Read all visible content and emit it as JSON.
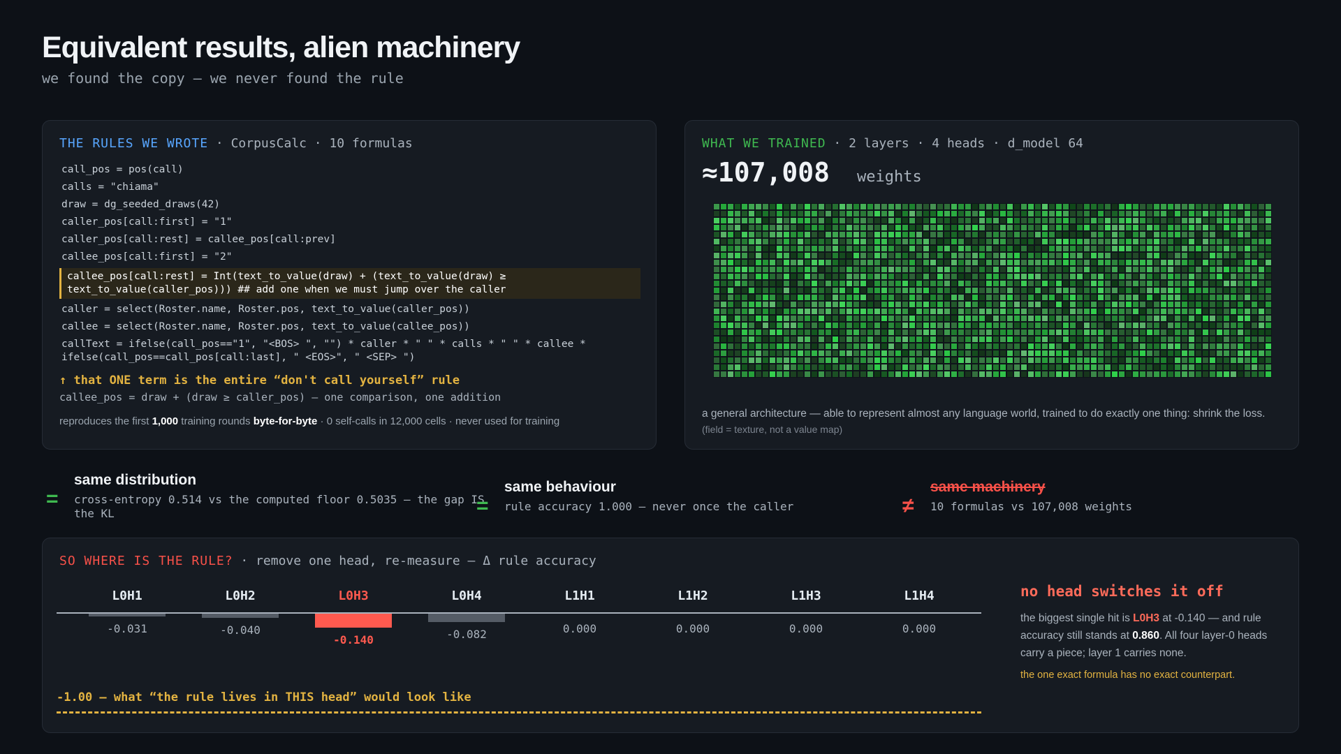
{
  "title": "Equivalent results, alien machinery",
  "subtitle": "we found the copy — we never found the rule",
  "rules_panel": {
    "head_key": "THE RULES WE WROTE",
    "head_rest": " · CorpusCalc · 10 formulas",
    "code_lines": [
      "call_pos = pos(call)",
      "calls = \"chiama\"",
      "draw = dg_seeded_draws(42)",
      "caller_pos[call:first] = \"1\"",
      "caller_pos[call:rest] = callee_pos[call:prev]",
      "callee_pos[call:first] = \"2\"",
      "callee_pos[call:rest] = Int(text_to_value(draw) + (text_to_value(draw) ≥ text_to_value(caller_pos))) ## add one when we must jump over the caller",
      "caller = select(Roster.name, Roster.pos, text_to_value(caller_pos))",
      "callee = select(Roster.name, Roster.pos, text_to_value(callee_pos))",
      "callText = ifelse(call_pos==\"1\", \"<BOS> \", \"\") * caller * \" \" * calls * \" \" * callee * ifelse(call_pos==call_pos[call:last], \" <EOS>\", \" <SEP> \")"
    ],
    "highlight_index": 6,
    "rule_note": "↑ that ONE term is the entire “don't call yourself” rule",
    "rule_formula": "callee_pos = draw + (draw ≥ caller_pos) — one comparison, one addition",
    "repro_prefix": "reproduces the first ",
    "repro_num": "1,000",
    "repro_mid": " training rounds ",
    "repro_bold": "byte-for-byte",
    "repro_suffix": " · 0 self-calls in 12,000 cells · never used for training"
  },
  "trained_panel": {
    "head_key": "WHAT WE TRAINED",
    "head_rest": " · 2 layers · 4 heads · d_model 64",
    "weights_num": "≈107,008",
    "weights_label": "weights",
    "note": "a general architecture — able to represent almost any language world, trained to do exactly one thing: shrink the loss.",
    "note_small": "(field = texture, not a value map)"
  },
  "comparisons": [
    {
      "symbol": "=",
      "title": "same distribution",
      "sub": "cross-entropy 0.514 vs the computed floor 0.5035 — the gap IS the KL",
      "color": "#3fb950"
    },
    {
      "symbol": "=",
      "title": "same behaviour",
      "sub": "rule accuracy 1.000 — never once the caller",
      "color": "#3fb950"
    },
    {
      "symbol": "≠",
      "title": "same machinery",
      "sub": "10 formulas vs 107,008 weights",
      "color": "#f85149"
    }
  ],
  "where_panel": {
    "head_key": "SO WHERE IS THE RULE?",
    "head_rest": " · remove one head, re-measure — Δ rule accuracy",
    "heads": [
      {
        "label": "L0H1",
        "value": "-0.031",
        "delta": -0.031
      },
      {
        "label": "L0H2",
        "value": "-0.040",
        "delta": -0.04
      },
      {
        "label": "L0H3",
        "value": "-0.140",
        "delta": -0.14
      },
      {
        "label": "L0H4",
        "value": "-0.082",
        "delta": -0.082
      },
      {
        "label": "L1H1",
        "value": "0.000",
        "delta": 0.0
      },
      {
        "label": "L1H2",
        "value": "0.000",
        "delta": 0.0
      },
      {
        "label": "L1H3",
        "value": "0.000",
        "delta": 0.0
      },
      {
        "label": "L1H4",
        "value": "0.000",
        "delta": 0.0
      }
    ],
    "highlight_head": "L0H3",
    "highlight_color": "#ff5a4f",
    "target_label": "-1.00 — what “the rule lives in THIS head” would look like",
    "side_title": "no head switches it off",
    "side_t1": "the biggest single hit is ",
    "side_head": "L0H3",
    "side_t2": " at -0.140 — and rule accuracy still stands at ",
    "side_acc": "0.860",
    "side_t3": ". All four layer-0 heads carry a piece; layer 1 carries none.",
    "side_note": "the one exact formula has no exact counterpart."
  }
}
